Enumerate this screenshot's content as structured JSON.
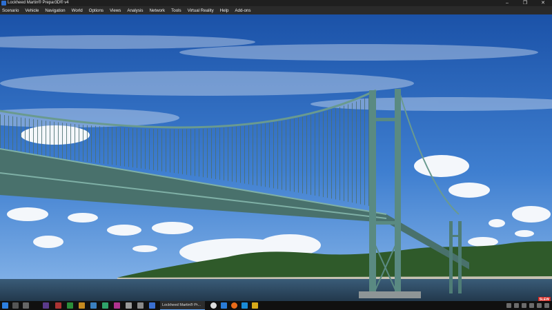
{
  "window": {
    "title": "Lockheed Martin® Prepar3D® v4",
    "controls": [
      "–",
      "❐",
      "✕"
    ]
  },
  "menu": {
    "items": [
      "Scenario",
      "Vehicle",
      "Navigation",
      "World",
      "Options",
      "Views",
      "Analysis",
      "Network",
      "Tools",
      "Virtual Reality",
      "Help",
      "Add-ons"
    ]
  },
  "status": {
    "slew": "SLEW"
  },
  "taskbar": {
    "active_window": "Lockheed Martin® Pr...",
    "pinned_icons": [
      "start-icon",
      "search-icon",
      "task-view-icon",
      "app-icon-1",
      "app-icon-2",
      "app-icon-3",
      "app-icon-4",
      "app-icon-5",
      "app-icon-6",
      "app-icon-7",
      "app-icon-8",
      "app-icon-9",
      "app-icon-10"
    ]
  },
  "colors": {
    "sky_top": "#1b52a8",
    "sky_bottom": "#6fa6e3",
    "water": "#2d4a64",
    "bridge": "#5a8a82",
    "slew_badge": "#d8261f"
  }
}
